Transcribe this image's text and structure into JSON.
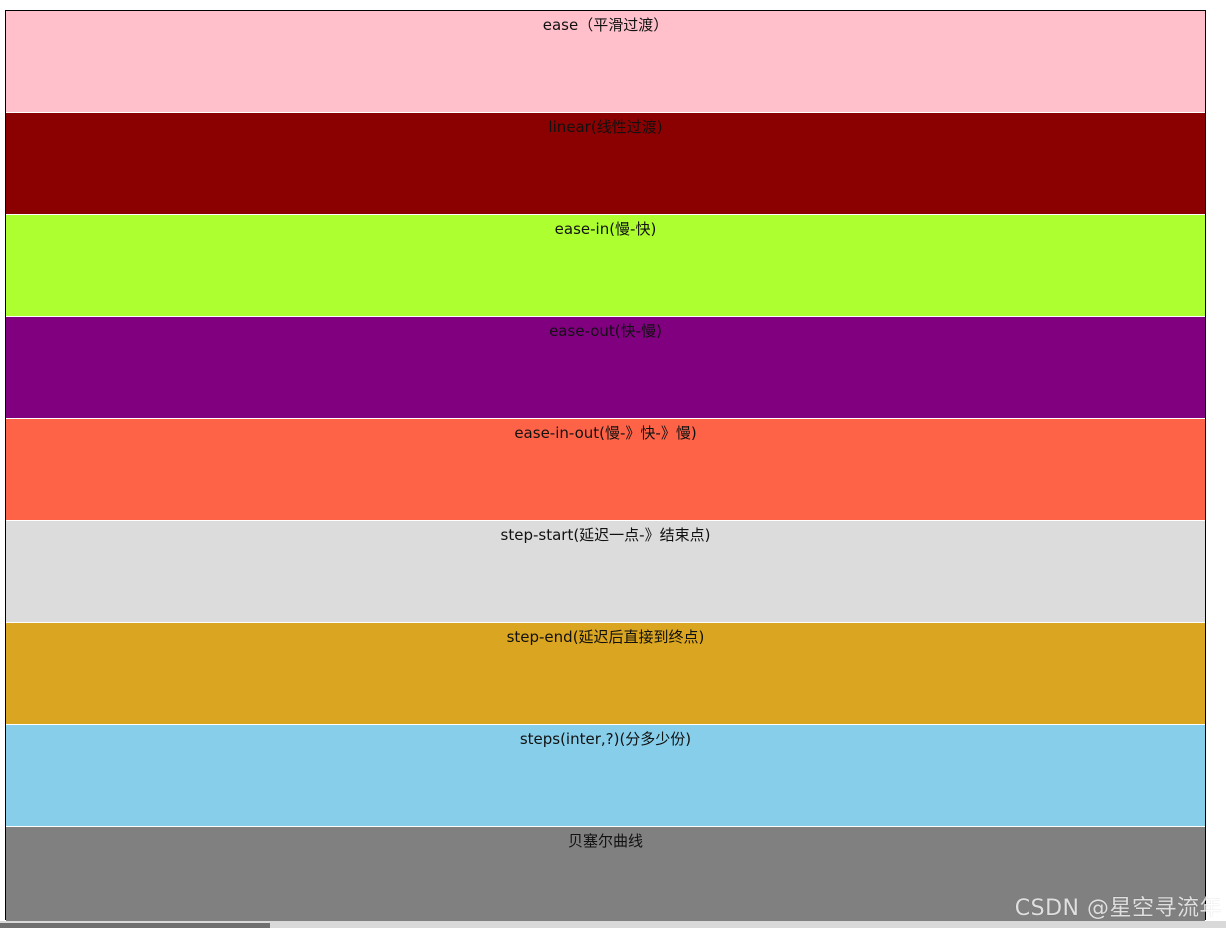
{
  "bands": [
    {
      "label": "ease（平滑过渡）",
      "color": "#ffc0cb"
    },
    {
      "label": "linear(线性过渡)",
      "color": "#8b0000"
    },
    {
      "label": "ease-in(慢-快)",
      "color": "#adff2f"
    },
    {
      "label": "ease-out(快-慢)",
      "color": "#800080"
    },
    {
      "label": "ease-in-out(慢-》快-》慢)",
      "color": "#ff6347"
    },
    {
      "label": "step-start(延迟一点-》结束点)",
      "color": "#dcdcdc"
    },
    {
      "label": "step-end(延迟后直接到终点)",
      "color": "#daa520"
    },
    {
      "label": "steps(inter,?)(分多少份)",
      "color": "#87ceeb"
    },
    {
      "label": "贝塞尔曲线",
      "color": "#808080"
    }
  ],
  "watermark": "CSDN @星空寻流年"
}
